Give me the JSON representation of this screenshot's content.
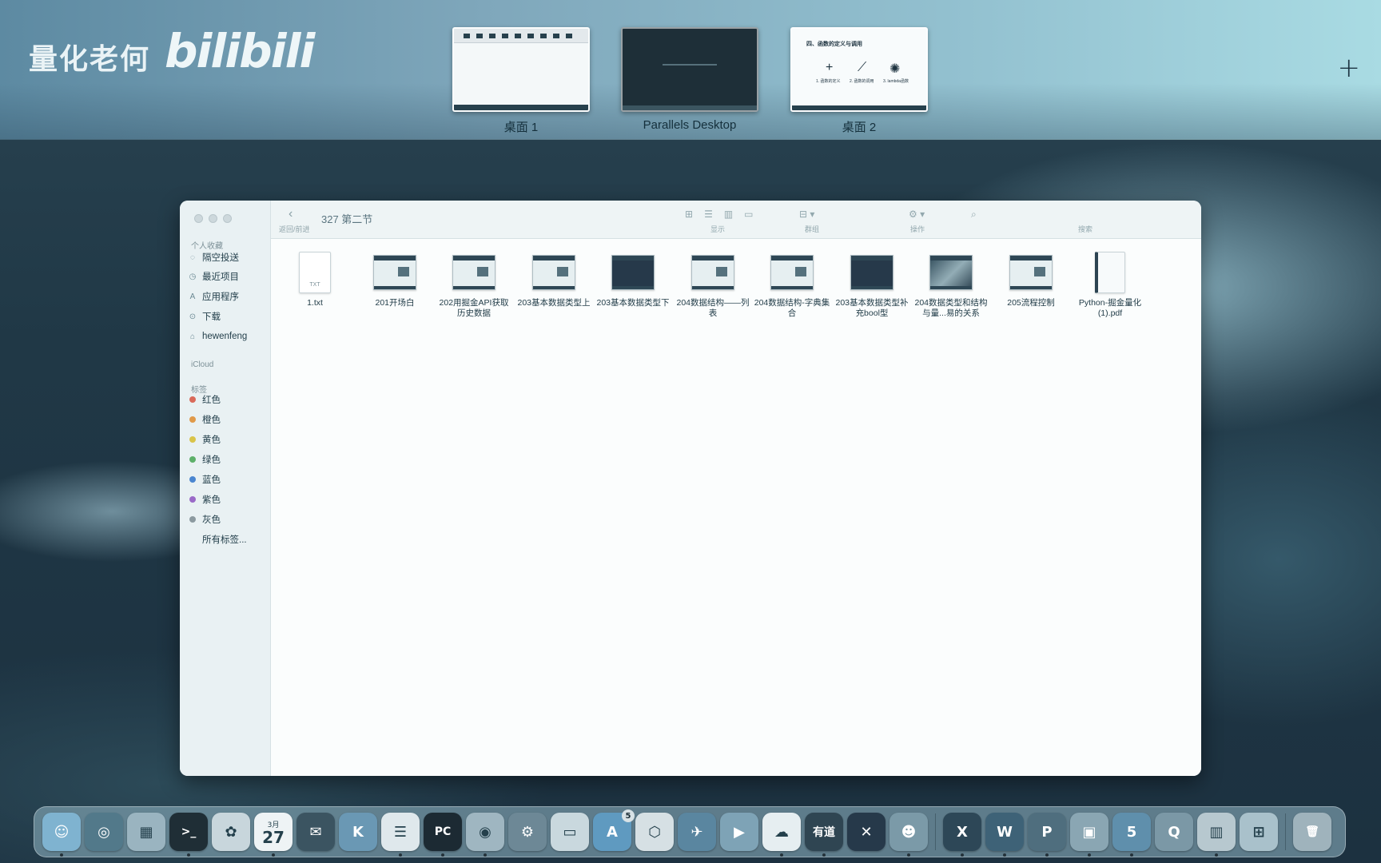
{
  "watermark": {
    "text": "量化老何",
    "logo": "bilibili"
  },
  "spaces": [
    {
      "label": "桌面 1"
    },
    {
      "label": "Parallels Desktop"
    },
    {
      "label": "桌面 2"
    }
  ],
  "space2_preview": {
    "heading": "四、函数的定义与调用",
    "captions": [
      "1. 函数的定义",
      "2. 函数的调用",
      "3. lambda函数"
    ]
  },
  "add_space_label": "+",
  "finder": {
    "title": "327 第二节",
    "back_symbol": "‹",
    "path_caption": "返回/前进",
    "toolbar_captions": {
      "view": "显示",
      "group": "群组",
      "action": "操作",
      "search": "搜索"
    },
    "sidebar": {
      "favorites_header": "个人收藏",
      "favorites": [
        "隔空投送",
        "最近项目",
        "应用程序",
        "下载",
        "hewenfeng"
      ],
      "icloud_header": "iCloud",
      "tags_header": "标签",
      "tags": [
        {
          "label": "红色",
          "color": "#d96a5a"
        },
        {
          "label": "橙色",
          "color": "#e09a4a"
        },
        {
          "label": "黄色",
          "color": "#d9c44a"
        },
        {
          "label": "绿色",
          "color": "#5db06a"
        },
        {
          "label": "蓝色",
          "color": "#4a86d0"
        },
        {
          "label": "紫色",
          "color": "#9a6ac8"
        },
        {
          "label": "灰色",
          "color": "#8c9aa0"
        }
      ],
      "all_tags": "所有标签..."
    },
    "files": [
      {
        "name": "1.txt",
        "kind": "txt",
        "ext": "TXT"
      },
      {
        "name": "201开场白",
        "kind": "video-light"
      },
      {
        "name": "202用掘金API获取历史数据",
        "kind": "video-light"
      },
      {
        "name": "203基本数据类型上",
        "kind": "video-light"
      },
      {
        "name": "203基本数据类型下",
        "kind": "video-dark"
      },
      {
        "name": "204数据结构——列表",
        "kind": "video-light"
      },
      {
        "name": "204数据结构-字典集合",
        "kind": "video-light"
      },
      {
        "name": "203基本数据类型补充bool型",
        "kind": "video-dark"
      },
      {
        "name": "204数据类型和结构与量...易的关系",
        "kind": "video-photo"
      },
      {
        "name": "205流程控制",
        "kind": "video-light"
      },
      {
        "name": "Python-掘金量化(1).pdf",
        "kind": "pdf"
      }
    ]
  },
  "dock": {
    "calendar": {
      "month": "3月",
      "day": "27"
    },
    "app_store_badge": "5",
    "apps": [
      {
        "name": "finder",
        "glyph": "☺",
        "color": "#7fb3d0"
      },
      {
        "name": "siri",
        "glyph": "◎",
        "color": "#52798a"
      },
      {
        "name": "launchpad",
        "glyph": "▦",
        "color": "#9ab4c0"
      },
      {
        "name": "terminal",
        "glyph": ">_",
        "color": "#1f2e36"
      },
      {
        "name": "photos",
        "glyph": "✿",
        "color": "#c8d6dc"
      },
      {
        "name": "calendar",
        "glyph": "",
        "color": "#eef3f5"
      },
      {
        "name": "mail-flag",
        "glyph": "✉",
        "color": "#3b5461"
      },
      {
        "name": "k-app",
        "glyph": "K",
        "color": "#6a98b4"
      },
      {
        "name": "reminders",
        "glyph": "☰",
        "color": "#dfe8ec"
      },
      {
        "name": "pycharm",
        "glyph": "PC",
        "color": "#1c2a33"
      },
      {
        "name": "chrome",
        "glyph": "◉",
        "color": "#9fb6c1"
      },
      {
        "name": "system-prefs",
        "glyph": "⚙",
        "color": "#6d8896"
      },
      {
        "name": "folder",
        "glyph": "▭",
        "color": "#c9d8de"
      },
      {
        "name": "app-store",
        "glyph": "A",
        "color": "#5f9ac0"
      },
      {
        "name": "security-app",
        "glyph": "⬡",
        "color": "#d6e0e4"
      },
      {
        "name": "feishu",
        "glyph": "✈",
        "color": "#5a86a0"
      },
      {
        "name": "player",
        "glyph": "▶",
        "color": "#7ea3b6"
      },
      {
        "name": "baidu-netdisk",
        "glyph": "☁",
        "color": "#e6eef1"
      },
      {
        "name": "youdao",
        "glyph": "有道",
        "color": "#2f4552"
      },
      {
        "name": "remote-desktop",
        "glyph": "✕",
        "color": "#26394a"
      },
      {
        "name": "wechat",
        "glyph": "☻",
        "color": "#7b9aa8"
      },
      {
        "name": "excel",
        "glyph": "X",
        "color": "#2d4757"
      },
      {
        "name": "word",
        "glyph": "W",
        "color": "#3e6277"
      },
      {
        "name": "powerpoint",
        "glyph": "P",
        "color": "#4f6e7e"
      },
      {
        "name": "preview",
        "glyph": "▣",
        "color": "#8aa6b3"
      },
      {
        "name": "number5-app",
        "glyph": "5",
        "color": "#5f8fac"
      },
      {
        "name": "quicktime",
        "glyph": "Q",
        "color": "#7b98a6"
      },
      {
        "name": "window-app",
        "glyph": "▥",
        "color": "#b7c8cf"
      },
      {
        "name": "windows-app",
        "glyph": "⊞",
        "color": "#a9c1cb"
      },
      {
        "name": "trash",
        "glyph": "🗑",
        "color": "#9fb3bc"
      }
    ]
  }
}
